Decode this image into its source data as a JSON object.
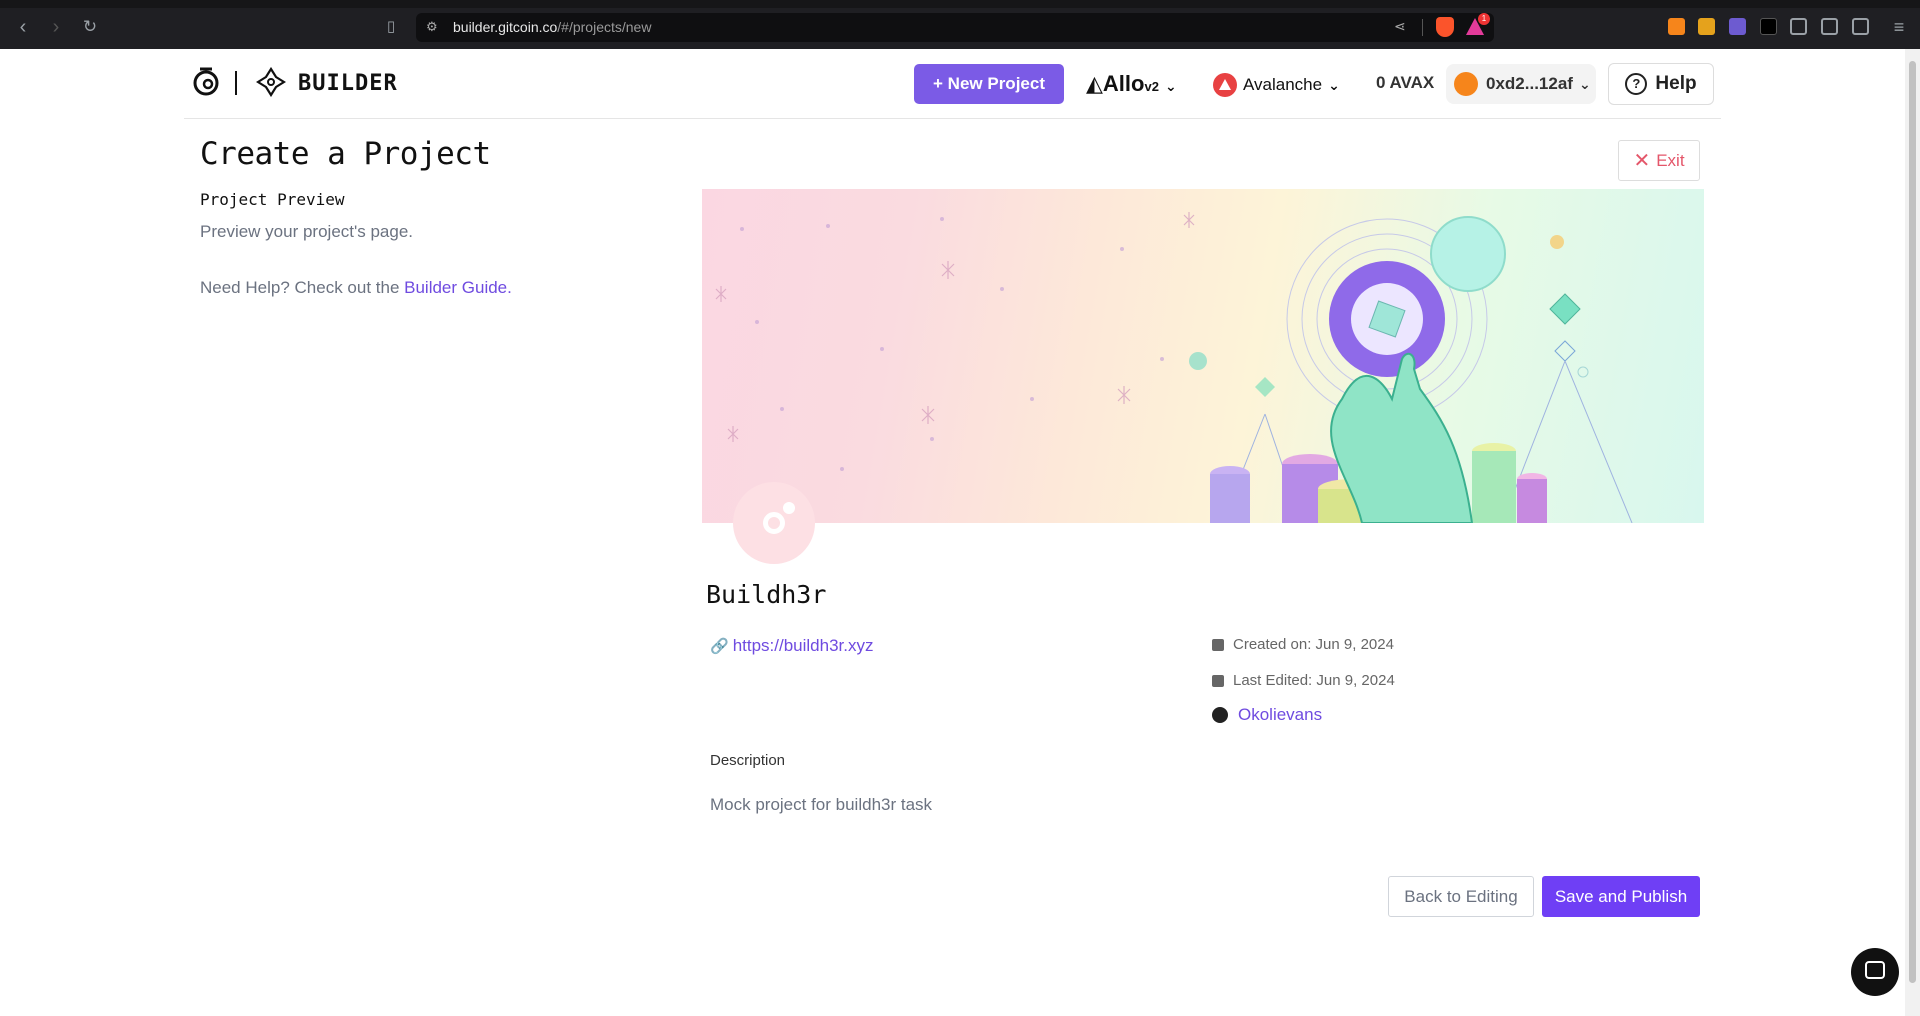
{
  "browser": {
    "url_host": "builder.gitcoin.co",
    "url_path": "/#/projects/new",
    "notification_count": "1"
  },
  "header": {
    "logo_text": "BUILDER",
    "new_project_label": "New Project",
    "allo_label": "Allo",
    "allo_version": "v2",
    "network_label": "Avalanche",
    "balance": "0 AVAX",
    "wallet_address": "0xd2...12af",
    "help_label": "Help"
  },
  "page": {
    "title": "Create a Project",
    "exit_label": "Exit",
    "section_title": "Project Preview",
    "section_desc": "Preview your project's page.",
    "help_prefix": "Need Help? Check out the ",
    "help_link": "Builder Guide."
  },
  "project": {
    "name": "Buildh3r",
    "website": "https://buildh3r.xyz",
    "created": "Created on: Jun 9, 2024",
    "edited": "Last Edited: Jun 9, 2024",
    "github": "Okolievans",
    "description_label": "Description",
    "description": "Mock project for buildh3r task"
  },
  "actions": {
    "back_label": "Back to Editing",
    "save_label": "Save and Publish"
  },
  "colors": {
    "accent": "#7b5be6",
    "primary": "#6f3ff5",
    "danger": "#e4566a"
  }
}
